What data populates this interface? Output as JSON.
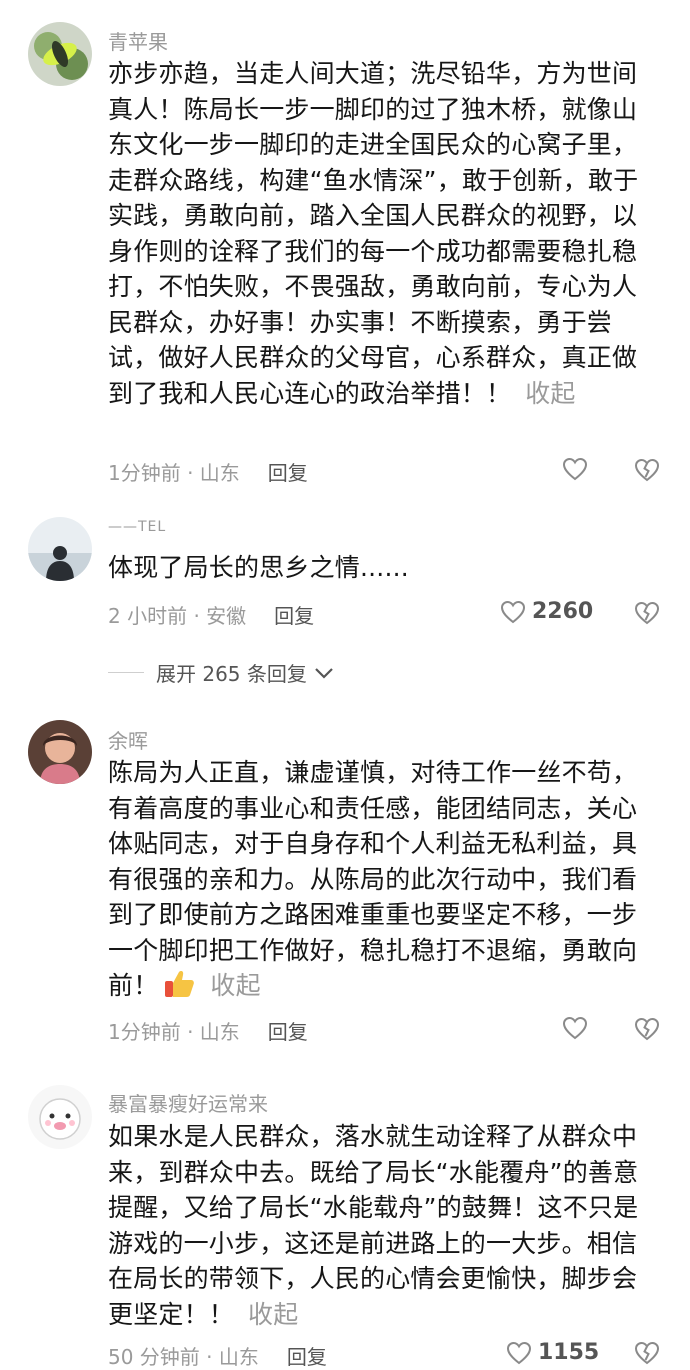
{
  "comments": [
    {
      "username": "青苹果",
      "text": "亦步亦趋，当走人间大道；洗尽铅华，方为世间真人！陈局长一步一脚印的过了独木桥，就像山东文化一步一脚印的走进全国民众的心窝子里，走群众路线，构建“鱼水情深”，敢于创新，敢于实践，勇敢向前，踏入全国人民群众的视野，以身作则的诠释了我们的每一个成功都需要稳扎稳打，不怕失败，不畏强敌，勇敢向前，专心为人民群众，办好事！办实事！不断摸索，勇于尝试，做好人民群众的父母官，心系群众，真正做到了我和人民心连心的政治举措！！",
      "collapse": "收起",
      "time": "1分钟前 · 山东",
      "reply": "回复",
      "likes": ""
    },
    {
      "username": "——TEL",
      "text": "体现了局长的思乡之情......",
      "time": "2 小时前 · 安徽",
      "reply": "回复",
      "likes": "2260"
    },
    {
      "username": "余晖",
      "text": "陈局为人正直，谦虚谨慎，对待工作一丝不苟，有着高度的事业心和责任感，能团结同志，关心体贴同志，对于自身存和个人利益无私利益，具有很强的亲和力。从陈局的此次行动中，我们看到了即使前方之路困难重重也要坚定不移，一步一个脚印把工作做好，稳扎稳打不退缩，勇敢向前！",
      "emoji": "thumbs-up-emoji",
      "collapse": "收起",
      "time": "1分钟前 · 山东",
      "reply": "回复",
      "likes": ""
    },
    {
      "username": "暴富暴瘦好运常来",
      "text": "如果水是人民群众，落水就生动诠释了从群众中来，到群众中去。既给了局长“水能覆舟”的善意提醒，又给了局长“水能载舟”的鼓舞！这不只是游戏的一小步，这还是前进路上的一大步。相信在局长的带领下，人民的心情会更愉快，脚步会更坚定！！",
      "collapse": "收起",
      "time": "50 分钟前 · 山东",
      "reply": "回复",
      "likes": "1155"
    }
  ],
  "expand_replies": {
    "label": "展开 265 条回复"
  },
  "colors": {
    "text": "#161616",
    "meta": "#9a9a9a",
    "reply": "#555555"
  },
  "icons": [
    "heart-outline-icon",
    "broken-heart-icon",
    "chevron-down-icon",
    "thumbs-up-emoji"
  ]
}
